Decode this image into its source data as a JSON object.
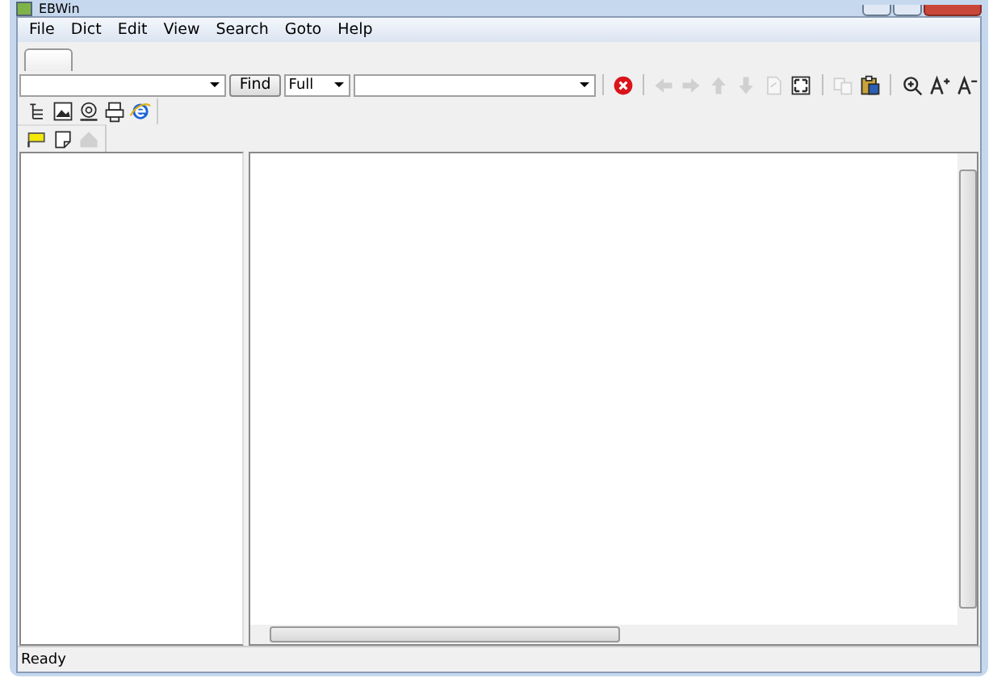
{
  "window": {
    "title": "EBWin"
  },
  "menu": [
    "File",
    "Dict",
    "Edit",
    "View",
    "Search",
    "Goto",
    "Help"
  ],
  "tabs": [
    {
      "selected": true
    }
  ],
  "search_bar": {
    "find_button": "Find",
    "mode": "Full"
  },
  "toolbar": [
    {
      "kind": "stop",
      "disabled": false
    },
    {
      "kind": "sep"
    },
    {
      "kind": "left",
      "disabled": true
    },
    {
      "kind": "right",
      "disabled": true
    },
    {
      "kind": "up",
      "disabled": true
    },
    {
      "kind": "down",
      "disabled": true
    },
    {
      "kind": "page",
      "disabled": true
    },
    {
      "kind": "fit",
      "disabled": false
    },
    {
      "kind": "sep"
    },
    {
      "kind": "copy",
      "disabled": true
    },
    {
      "kind": "paste",
      "disabled": false
    },
    {
      "kind": "sep"
    },
    {
      "kind": "zoom",
      "disabled": false
    },
    {
      "kind": "bigger",
      "disabled": false
    },
    {
      "kind": "smaller",
      "disabled": false
    }
  ],
  "view_tools": [
    {
      "kind": "tree",
      "disabled": false
    },
    {
      "kind": "picture",
      "disabled": false
    },
    {
      "kind": "disc",
      "disabled": false
    },
    {
      "kind": "printer",
      "disabled": false
    },
    {
      "kind": "browser",
      "disabled": false
    }
  ],
  "note_tools": [
    {
      "kind": "flag",
      "disabled": false
    },
    {
      "kind": "memo",
      "disabled": false
    },
    {
      "kind": "home",
      "disabled": true
    }
  ],
  "status_bar": {
    "text": "Ready"
  }
}
